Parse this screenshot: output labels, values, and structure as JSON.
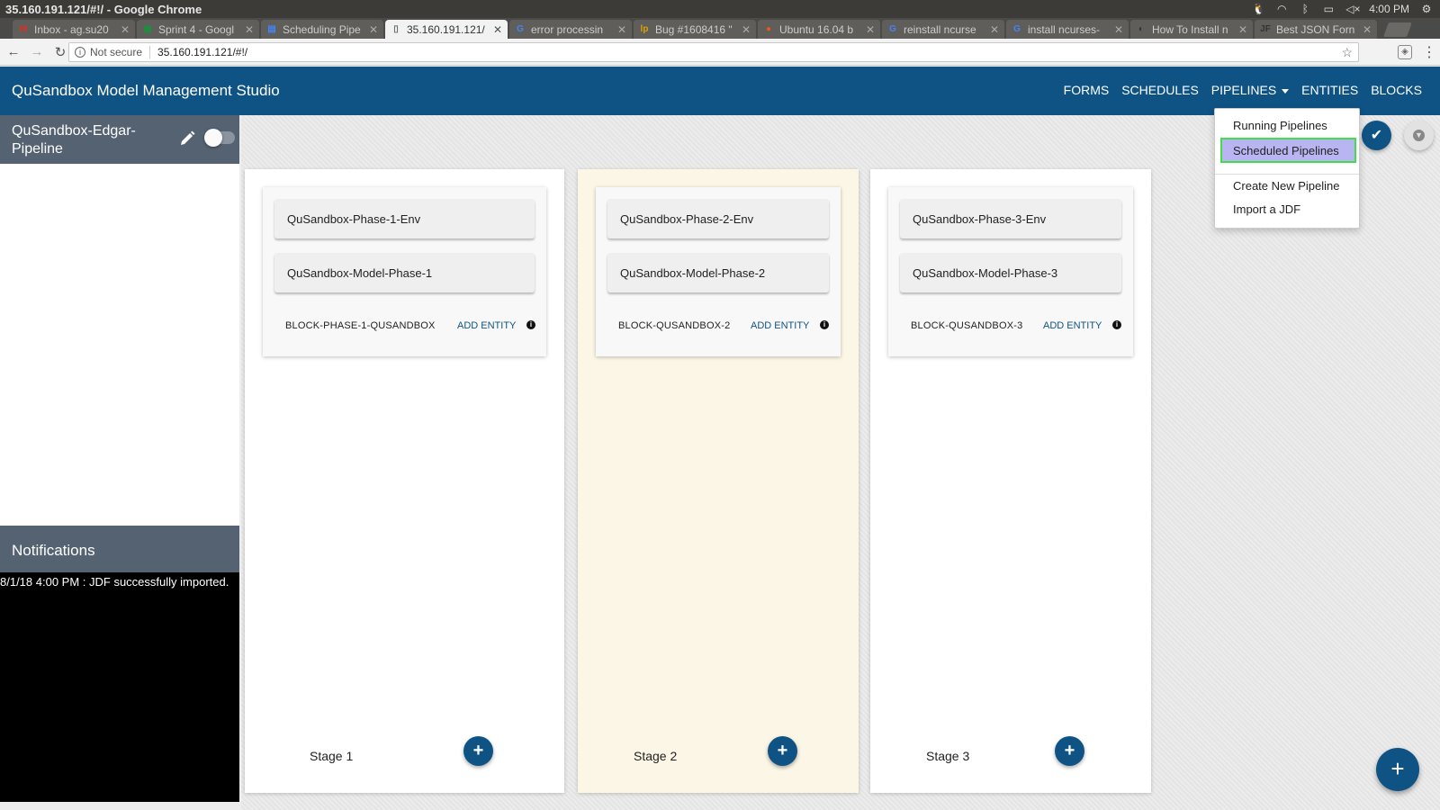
{
  "os": {
    "window_title": "35.160.191.121/#!/ - Google Chrome",
    "clock": "4:00 PM"
  },
  "browser": {
    "tabs": [
      {
        "label": "Inbox - ag.su20",
        "favicon": "M",
        "favicon_color": "#d93025"
      },
      {
        "label": "Sprint 4 - Googl",
        "favicon": "▦",
        "favicon_color": "#1e8e3e"
      },
      {
        "label": "Scheduling Pipe",
        "favicon": "▤",
        "favicon_color": "#4285f4"
      },
      {
        "label": "35.160.191.121/",
        "favicon": "▯",
        "favicon_color": "#666666"
      },
      {
        "label": "error processin",
        "favicon": "G",
        "favicon_color": "#4285f4"
      },
      {
        "label": "Bug #1608416 \"",
        "favicon": "lp",
        "favicon_color": "#d8a200"
      },
      {
        "label": "Ubuntu 16.04 b",
        "favicon": "ask",
        "favicon_color": "#e95420"
      },
      {
        "label": "reinstall ncurse",
        "favicon": "G",
        "favicon_color": "#4285f4"
      },
      {
        "label": "install ncurses-",
        "favicon": "G",
        "favicon_color": "#4285f4"
      },
      {
        "label": "How To Install n",
        "favicon": "◐",
        "favicon_color": "#333333"
      },
      {
        "label": "Best JSON Forn",
        "favicon": "JF",
        "favicon_color": "#333333"
      }
    ],
    "active_tab_index": 3,
    "security_label": "Not secure",
    "url": "35.160.191.121/#!/"
  },
  "app": {
    "title": "QuSandbox Model Management Studio",
    "nav": {
      "forms": "FORMS",
      "schedules": "SCHEDULES",
      "pipelines": "PIPELINES",
      "entities": "ENTITIES",
      "blocks": "BLOCKS"
    },
    "pipeline_name": "QuSandbox-Edgar-Pipeline",
    "pipeline_enabled": false,
    "notifications_title": "Notifications",
    "notifications": [
      "8/1/18 4:00 PM : JDF successfully imported."
    ],
    "dropdown": {
      "running": "Running Pipelines",
      "scheduled": "Scheduled Pipelines",
      "create": "Create New Pipeline",
      "import": "Import a JDF"
    },
    "stages": [
      {
        "label": "Stage 1",
        "entities": [
          "QuSandbox-Phase-1-Env",
          "QuSandbox-Model-Phase-1"
        ],
        "block": "BLOCK-PHASE-1-QUSANDBOX",
        "add_entity": "ADD ENTITY"
      },
      {
        "label": "Stage 2",
        "entities": [
          "QuSandbox-Phase-2-Env",
          "QuSandbox-Model-Phase-2"
        ],
        "block": "BLOCK-QUSANDBOX-2",
        "add_entity": "ADD ENTITY"
      },
      {
        "label": "Stage 3",
        "entities": [
          "QuSandbox-Phase-3-Env",
          "QuSandbox-Model-Phase-3"
        ],
        "block": "BLOCK-QUSANDBOX-3",
        "add_entity": "ADD ENTITY"
      }
    ],
    "colors": {
      "primary": "#0e5384",
      "sidebar": "#556272",
      "highlight_stage": "#fcf6e6",
      "selected_item": "#b9b5f3",
      "selected_border": "#3ee04a"
    }
  }
}
